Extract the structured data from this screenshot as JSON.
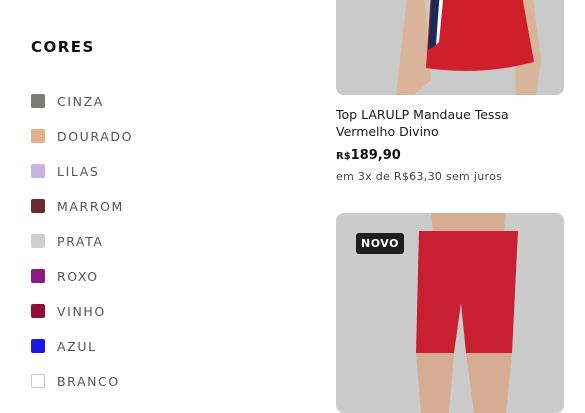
{
  "filter": {
    "title": "CORES",
    "colors": [
      {
        "label": "CINZA",
        "hex": "#7d7b77"
      },
      {
        "label": "DOURADO",
        "hex": "#e7b08c"
      },
      {
        "label": "LILAS",
        "hex": "#c6b2e3"
      },
      {
        "label": "MARROM",
        "hex": "#6b2b2b"
      },
      {
        "label": "PRATA",
        "hex": "#cfcfd2"
      },
      {
        "label": "ROXO",
        "hex": "#8a1a86"
      },
      {
        "label": "VINHO",
        "hex": "#8f0f3a"
      },
      {
        "label": "AZUL",
        "hex": "#1a1ae6"
      },
      {
        "label": "BRANCO",
        "hex": "#ffffff"
      }
    ]
  },
  "products": [
    {
      "name": "Top LARULP Mandaue Tessa Vermelho Divino",
      "currency": "R$",
      "price": "189,90",
      "installments": "em 3x de R$63,30 sem juros"
    },
    {
      "badge": "NOVO"
    }
  ]
}
